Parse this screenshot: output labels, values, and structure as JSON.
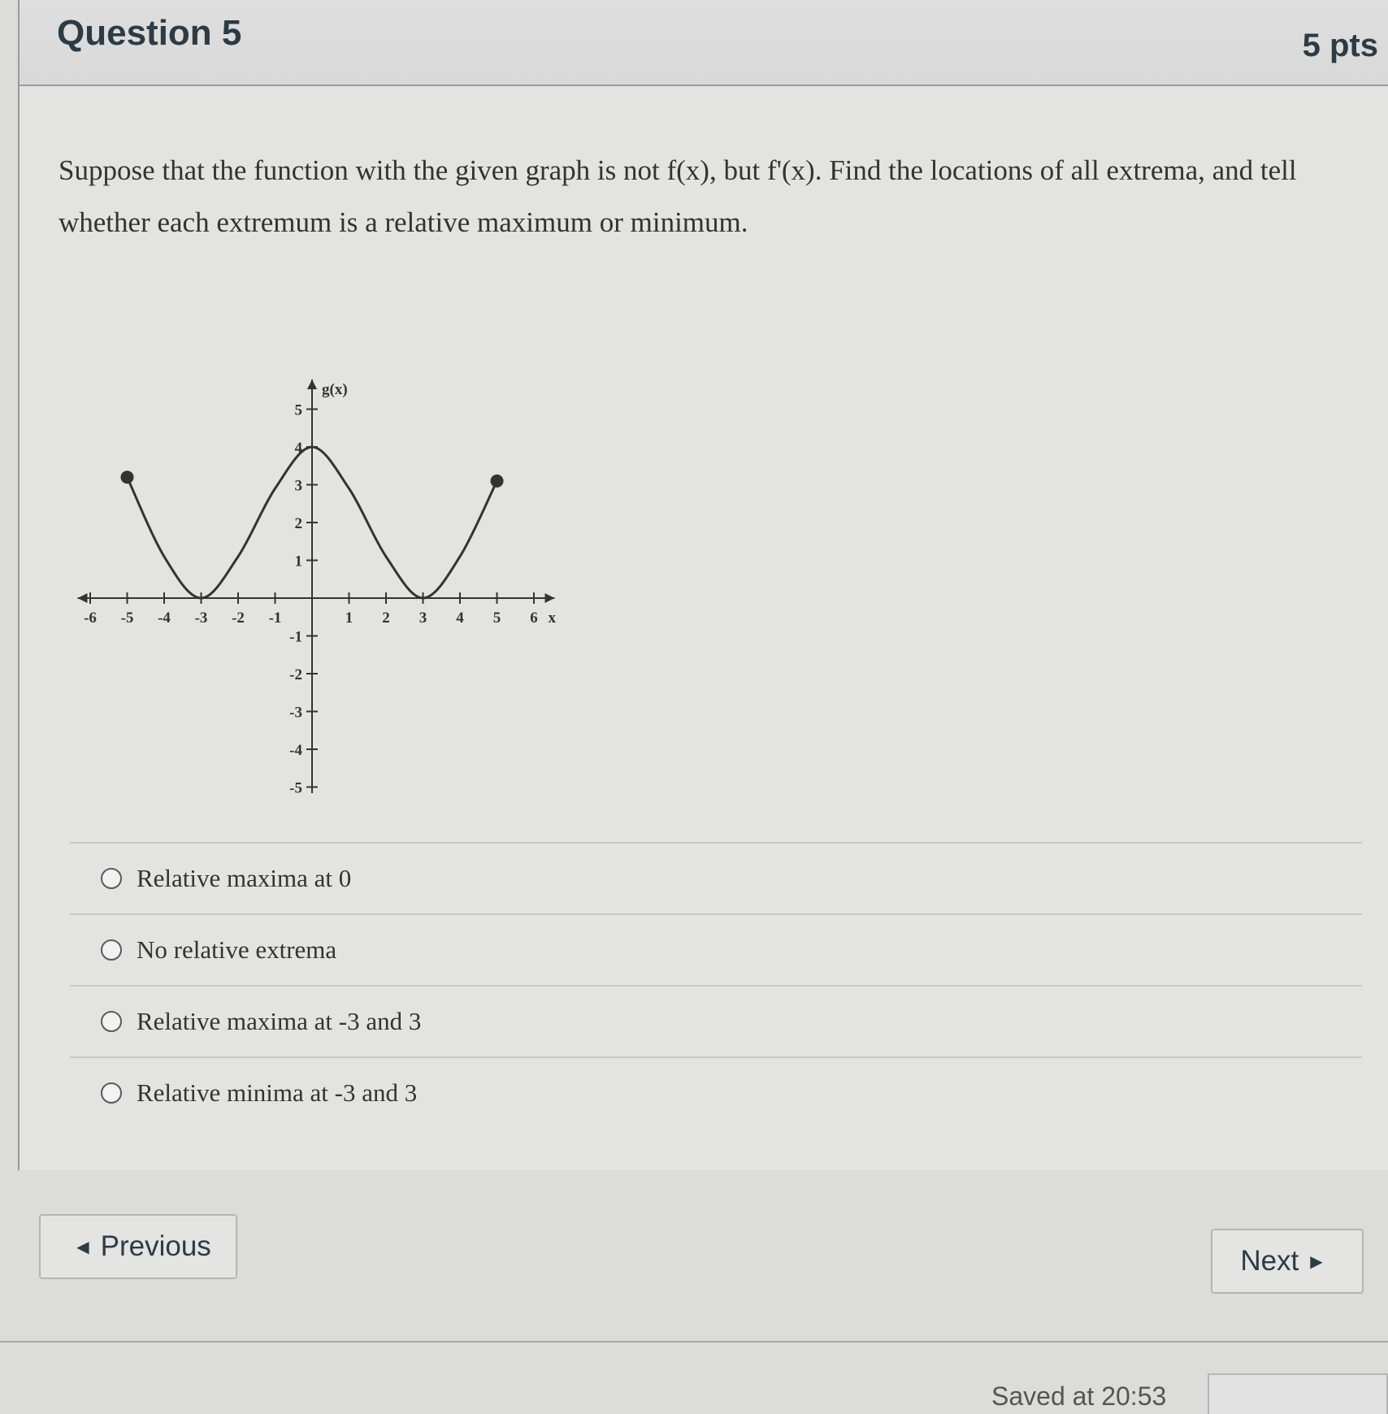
{
  "question": {
    "title": "Question 5",
    "points": "5 pts",
    "text": "Suppose that the function with the given graph is not f(x), but f'(x). Find the locations of all extrema, and tell whether each extremum is a relative maximum or minimum."
  },
  "graph": {
    "y_label": "g(x)",
    "x_label": "x",
    "x_ticks": [
      -6,
      -5,
      -4,
      -3,
      -2,
      -1,
      1,
      2,
      3,
      4,
      5,
      6
    ],
    "y_ticks": [
      5,
      4,
      3,
      2,
      1,
      -1,
      -2,
      -3,
      -4,
      -5
    ],
    "xlim": [
      -7,
      7
    ],
    "ylim": [
      -6,
      6
    ],
    "curve": [
      {
        "x": -5,
        "y": 3.2
      },
      {
        "x": -4,
        "y": 1.1
      },
      {
        "x": -3,
        "y": 0
      },
      {
        "x": -2,
        "y": 1.1
      },
      {
        "x": -1,
        "y": 2.9
      },
      {
        "x": 0,
        "y": 4
      },
      {
        "x": 1,
        "y": 2.9
      },
      {
        "x": 2,
        "y": 1.1
      },
      {
        "x": 3,
        "y": 0
      },
      {
        "x": 4,
        "y": 1.1
      },
      {
        "x": 5,
        "y": 3.1
      }
    ],
    "endpoints": [
      {
        "x": -5,
        "y": 3.2
      },
      {
        "x": 5,
        "y": 3.1
      }
    ]
  },
  "answers": [
    {
      "label": "Relative maxima at 0"
    },
    {
      "label": "No relative extrema"
    },
    {
      "label": "Relative maxima at -3 and 3"
    },
    {
      "label": "Relative minima at -3 and 3"
    }
  ],
  "nav": {
    "previous_label": "Previous",
    "next_label": "Next",
    "saved_text": "Saved at 20:53"
  }
}
